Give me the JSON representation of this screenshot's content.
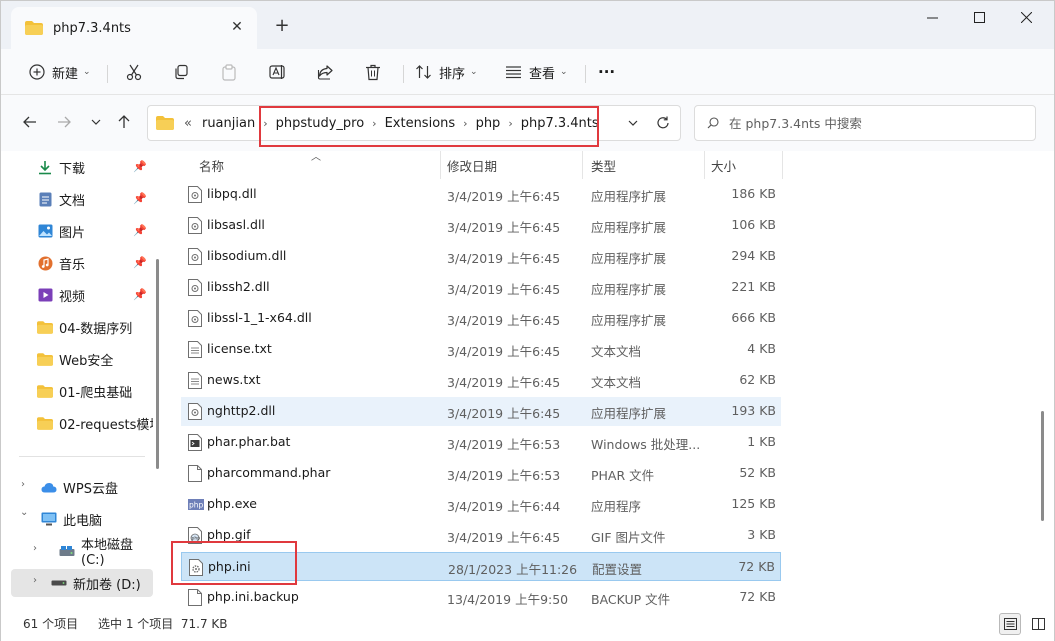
{
  "tab": {
    "title": "php7.3.4nts",
    "close_icon": "close-icon",
    "new_tab_label": "+"
  },
  "toolbar": {
    "new_label": "新建",
    "sort_label": "排序",
    "view_label": "查看",
    "more_label": "···"
  },
  "breadcrumb": {
    "overflow": "«",
    "items": [
      "ruanjian",
      "phpstudy_pro",
      "Extensions",
      "php",
      "php7.3.4nts"
    ]
  },
  "search": {
    "placeholder": "在 php7.3.4nts 中搜索"
  },
  "sidebar": {
    "pinned": [
      {
        "label": "下载",
        "icon": "download-icon"
      },
      {
        "label": "文档",
        "icon": "document-icon"
      },
      {
        "label": "图片",
        "icon": "picture-icon"
      },
      {
        "label": "音乐",
        "icon": "music-icon"
      },
      {
        "label": "视频",
        "icon": "video-icon"
      }
    ],
    "folders": [
      "04-数据序列",
      "Web安全",
      "01-爬虫基础",
      "02-requests模块"
    ],
    "tree": [
      {
        "label": "WPS云盘",
        "icon": "cloud-icon",
        "expander": "›"
      },
      {
        "label": "此电脑",
        "icon": "computer-icon",
        "expander": "⌄"
      },
      {
        "label": "本地磁盘 (C:)",
        "icon": "disk-icon",
        "expander": "›"
      },
      {
        "label": "新加卷 (D:)",
        "icon": "drive-icon",
        "expander": "›"
      }
    ]
  },
  "columns": {
    "name": "名称",
    "date": "修改日期",
    "type": "类型",
    "size": "大小"
  },
  "files": [
    {
      "name": "libpq.dll",
      "date": "3/4/2019 上午6:45",
      "type": "应用程序扩展",
      "size": "186 KB",
      "icon": "dll"
    },
    {
      "name": "libsasl.dll",
      "date": "3/4/2019 上午6:45",
      "type": "应用程序扩展",
      "size": "106 KB",
      "icon": "dll"
    },
    {
      "name": "libsodium.dll",
      "date": "3/4/2019 上午6:45",
      "type": "应用程序扩展",
      "size": "294 KB",
      "icon": "dll"
    },
    {
      "name": "libssh2.dll",
      "date": "3/4/2019 上午6:45",
      "type": "应用程序扩展",
      "size": "221 KB",
      "icon": "dll"
    },
    {
      "name": "libssl-1_1-x64.dll",
      "date": "3/4/2019 上午6:45",
      "type": "应用程序扩展",
      "size": "666 KB",
      "icon": "dll"
    },
    {
      "name": "license.txt",
      "date": "3/4/2019 上午6:45",
      "type": "文本文档",
      "size": "4 KB",
      "icon": "txt"
    },
    {
      "name": "news.txt",
      "date": "3/4/2019 上午6:45",
      "type": "文本文档",
      "size": "62 KB",
      "icon": "txt"
    },
    {
      "name": "nghttp2.dll",
      "date": "3/4/2019 上午6:45",
      "type": "应用程序扩展",
      "size": "193 KB",
      "icon": "dll"
    },
    {
      "name": "phar.phar.bat",
      "date": "3/4/2019 上午6:53",
      "type": "Windows 批处理...",
      "size": "1 KB",
      "icon": "bat"
    },
    {
      "name": "pharcommand.phar",
      "date": "3/4/2019 上午6:53",
      "type": "PHAR 文件",
      "size": "52 KB",
      "icon": "blank"
    },
    {
      "name": "php.exe",
      "date": "3/4/2019 上午6:44",
      "type": "应用程序",
      "size": "125 KB",
      "icon": "php"
    },
    {
      "name": "php.gif",
      "date": "3/4/2019 上午6:45",
      "type": "GIF 图片文件",
      "size": "3 KB",
      "icon": "gif"
    },
    {
      "name": "php.ini",
      "date": "28/1/2023 上午11:26",
      "type": "配置设置",
      "size": "72 KB",
      "icon": "ini"
    },
    {
      "name": "php.ini.backup",
      "date": "13/4/2019 上午9:50",
      "type": "BACKUP 文件",
      "size": "72 KB",
      "icon": "blank"
    }
  ],
  "status": {
    "count": "61 个项目",
    "selection": "选中 1 个项目  71.7 KB"
  },
  "colors": {
    "highlight": "#e0393e",
    "selected_row": "#cce4f7",
    "hover_row": "#e9f2fb",
    "folder": "#f3c13a"
  }
}
